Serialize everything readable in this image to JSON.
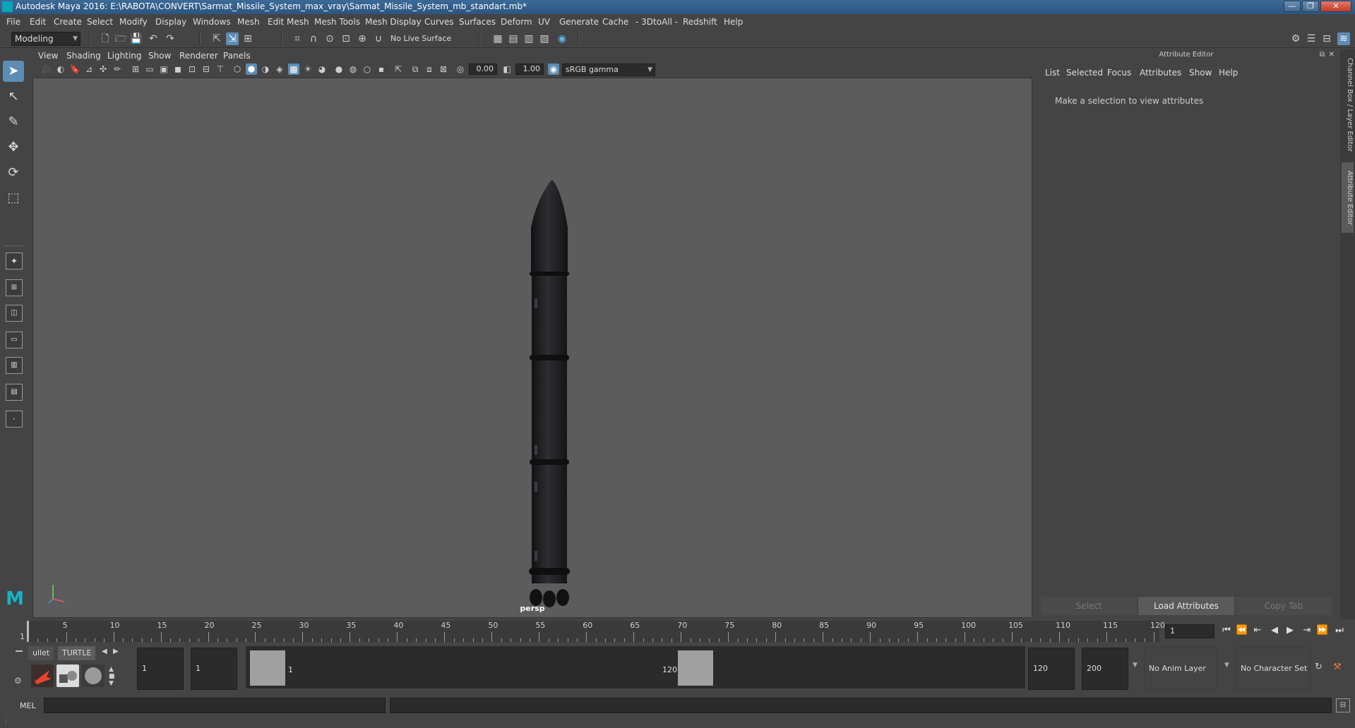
{
  "window": {
    "title": "Autodesk Maya 2016: E:\\RABOTA\\CONVERT\\Sarmat_Missile_System_max_vray\\Sarmat_Missile_System_mb_standart.mb*",
    "minimize": "—",
    "maximize": "❐",
    "close": "✕"
  },
  "menubar": [
    "File",
    "Edit",
    "Create",
    "Select",
    "Modify",
    "Display",
    "Windows",
    "Mesh",
    "Edit Mesh",
    "Mesh Tools",
    "Mesh Display",
    "Curves",
    "Surfaces",
    "Deform",
    "UV",
    "Generate",
    "Cache",
    "- 3DtoAll -",
    "Redshift",
    "Help"
  ],
  "statusline": {
    "menuset": "Modeling",
    "live_surface": "No Live Surface"
  },
  "panel": {
    "menus": [
      "View",
      "Shading",
      "Lighting",
      "Show",
      "Renderer",
      "Panels"
    ],
    "exposure": "0.00",
    "gamma": "1.00",
    "color_space": "sRGB gamma",
    "camera": "persp"
  },
  "attribute_editor": {
    "title": "Attribute Editor",
    "menus": [
      "List",
      "Selected",
      "Focus",
      "Attributes",
      "Show",
      "Help"
    ],
    "empty_message": "Make a selection to view attributes",
    "buttons": {
      "select": "Select",
      "load": "Load Attributes",
      "copy_tab": "Copy Tab"
    }
  },
  "side_tabs": {
    "channel_box": "Channel Box / Layer Editor",
    "attribute_editor": "Attribute Editor"
  },
  "timeslider": {
    "ticks": [
      "5",
      "10",
      "15",
      "20",
      "25",
      "30",
      "35",
      "40",
      "45",
      "50",
      "55",
      "60",
      "65",
      "70",
      "75",
      "80",
      "85",
      "90",
      "95",
      "100",
      "105",
      "110",
      "115",
      "120"
    ],
    "current_label": "1",
    "current_frame": "1"
  },
  "shelf": {
    "tabs": [
      "ullet",
      "TURTLE"
    ]
  },
  "range": {
    "start": "1",
    "playback_start": "1",
    "range_start_label": "1",
    "range_end_label": "120",
    "playback_end": "120",
    "end": "200",
    "anim_layer": "No Anim Layer",
    "character_set": "No Character Set"
  },
  "cmdline": {
    "label": "MEL"
  },
  "colors": {
    "accent": "#5d8db3",
    "viewport_bg": "#5c5c5c",
    "missile": "#202022"
  }
}
